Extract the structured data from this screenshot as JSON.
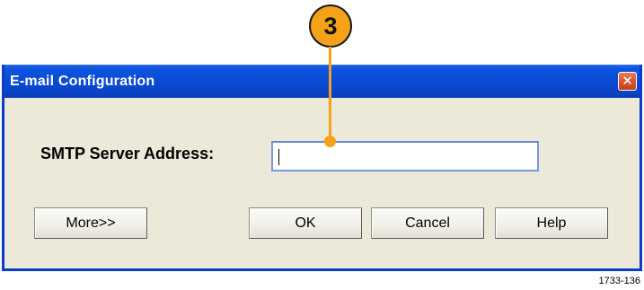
{
  "callout": {
    "number": "3",
    "color": "#f5a21a"
  },
  "dialog": {
    "title": "E-mail Configuration",
    "close_icon": "close-x",
    "smtp_label": "SMTP Server Address:",
    "smtp_value": "",
    "buttons": {
      "more": "More>>",
      "ok": "OK",
      "cancel": "Cancel",
      "help": "Help"
    },
    "colors": {
      "titlebar": "#0a4bd6",
      "body": "#ece9d8",
      "close_button": "#d4532f"
    }
  },
  "figure_id": "1733-136"
}
